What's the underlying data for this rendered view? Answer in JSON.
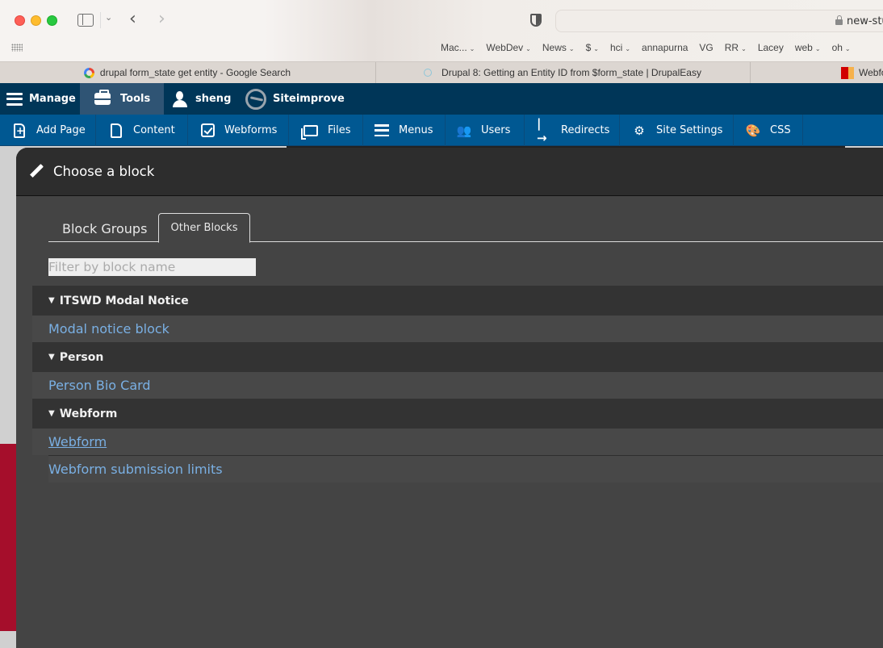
{
  "browser": {
    "url_text": "new-stu",
    "bookmarks": [
      {
        "label": "Mac...",
        "dropdown": true
      },
      {
        "label": "WebDev",
        "dropdown": true
      },
      {
        "label": "News",
        "dropdown": true
      },
      {
        "label": "$",
        "dropdown": true
      },
      {
        "label": "hci",
        "dropdown": true
      },
      {
        "label": "annapurna",
        "dropdown": false
      },
      {
        "label": "VG",
        "dropdown": false
      },
      {
        "label": "RR",
        "dropdown": true
      },
      {
        "label": "Lacey",
        "dropdown": false
      },
      {
        "label": "web",
        "dropdown": true
      },
      {
        "label": "oh",
        "dropdown": true
      }
    ],
    "tabs": [
      {
        "title": "drupal form_state get entity - Google Search",
        "icon": "google-icon"
      },
      {
        "title": "Drupal 8: Getting an Entity ID from $form_state | DrupalEasy",
        "icon": "drupaleasy-icon"
      },
      {
        "title": "Webfo",
        "icon": "webform-icon"
      }
    ]
  },
  "toolbar": {
    "top": [
      {
        "label": "Manage",
        "icon": "hamburger-icon"
      },
      {
        "label": "Tools",
        "icon": "toolbox-icon"
      },
      {
        "label": "sheng",
        "icon": "user-icon"
      },
      {
        "label": "Siteimprove",
        "icon": "siteimprove-icon"
      }
    ],
    "tray": [
      {
        "label": "Add Page",
        "icon": "add-page-icon"
      },
      {
        "label": "Content",
        "icon": "document-icon"
      },
      {
        "label": "Webforms",
        "icon": "checkbox-icon"
      },
      {
        "label": "Files",
        "icon": "folder-icon"
      },
      {
        "label": "Menus",
        "icon": "menu-icon"
      },
      {
        "label": "Users",
        "icon": "users-icon"
      },
      {
        "label": "Redirects",
        "icon": "redirect-icon"
      },
      {
        "label": "Site Settings",
        "icon": "gears-icon"
      },
      {
        "label": "CSS",
        "icon": "palette-icon"
      }
    ]
  },
  "dialog": {
    "title": "Choose a block",
    "tabs": [
      {
        "label": "Block Groups",
        "active": false
      },
      {
        "label": "Other Blocks",
        "active": true
      }
    ],
    "filter_placeholder": "Filter by block name",
    "filter_value": "",
    "groups": [
      {
        "name": "ITSWD Modal Notice",
        "items": [
          "Modal notice block"
        ]
      },
      {
        "name": "Person",
        "items": [
          "Person Bio Card"
        ]
      },
      {
        "name": "Webform",
        "items": [
          "Webform",
          "Webform submission limits"
        ]
      }
    ]
  },
  "colors": {
    "toolbar_top": "#003658",
    "toolbar_tray": "#005892",
    "link": "#7ab0e4",
    "dialog_bg": "#444444",
    "page_accent": "#a50e2b"
  }
}
